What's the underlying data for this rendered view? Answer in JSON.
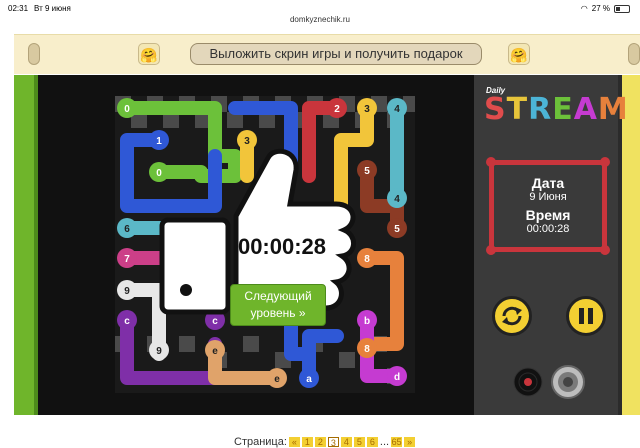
{
  "status": {
    "time": "02:31",
    "date": "Вт 9 июня",
    "battery": "27 %",
    "url": "domkyznechik.ru"
  },
  "banner": {
    "cta_label": "Выложить скрин игры и получить подарок",
    "emoji_left": "🤗",
    "emoji_right": "🤗"
  },
  "game": {
    "timer": "00:00:28",
    "next_label_line1": "Следующий",
    "next_label_line2": "уровень »",
    "nodes": {
      "n0a": "0",
      "n1": "1",
      "n0b": "0",
      "n2": "2",
      "n3a": "3",
      "n4a": "4",
      "n3b": "3",
      "n5a": "5",
      "n4b": "4",
      "n5b": "5",
      "n6": "6",
      "n7": "7",
      "n8a": "8",
      "n9a": "9",
      "nb1": "b",
      "nc1": "c",
      "nc2": "c",
      "nb2": "b",
      "n9b": "9",
      "ne1": "e",
      "n8b": "8",
      "ne2": "e",
      "na": "a",
      "nd": "d"
    }
  },
  "panel": {
    "logo_daily": "Daily",
    "logo_stream": [
      "S",
      "T",
      "R",
      "E",
      "A",
      "M"
    ],
    "date_label": "Дата",
    "date_value": "9 Июня",
    "time_label": "Время",
    "time_value": "00:00:28"
  },
  "pager": {
    "label": "Страница:",
    "prev": "«",
    "pages": [
      "1",
      "2",
      "3",
      "4",
      "5",
      "6"
    ],
    "current": "3",
    "ellipsis": "...",
    "last": "65",
    "next": "»"
  },
  "colors": {
    "green": "#6cc13a",
    "blue": "#2f58d6",
    "yellow": "#f2c53a",
    "teal": "#5bb8c7",
    "red": "#c9353c",
    "brown": "#8c3b25",
    "orange": "#e7813c",
    "pink": "#cc3f88",
    "purple": "#7f2fa8",
    "white": "#e7e7e7",
    "tan": "#e0a36a",
    "magenta": "#c53bd1",
    "logo_stream": [
      "#e04c4c",
      "#e7c53a",
      "#4cb4d6",
      "#6cc13a",
      "#c53bd1",
      "#e7813c"
    ]
  }
}
